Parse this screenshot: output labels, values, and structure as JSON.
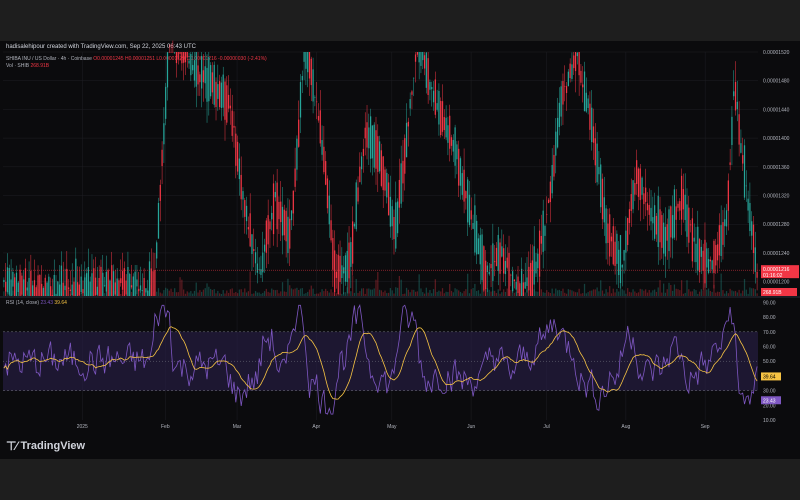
{
  "header": {
    "attribution": "hadisalehipour created with TradingView.com, Sep 22, 2025 06:43 UTC"
  },
  "legend": {
    "symbol": "SHIBA INU / US Dollar · 4h · Coinbase",
    "open": "O0.00001245",
    "high": "H0.00001251",
    "low": "L0.00001179",
    "close": "C0.00001216",
    "change": "-0.00000030 (-2.41%)",
    "vol_label": "Vol · SHIB",
    "vol_value": "268.91B"
  },
  "rsi_legend": {
    "label": "RSI (14, close)",
    "rsi_value": "23.43",
    "ma_value": "39.64"
  },
  "brand": {
    "name": "TradingView",
    "logo_icon": "tradingview-logo-icon"
  },
  "colors": {
    "up": "#26a69a",
    "down": "#f23645",
    "rsi_line": "#7e57c2",
    "rsi_ma": "#f6c343",
    "rsi_band": "#2a1f4a",
    "grid": "#1f1f24",
    "background": "#0b0b0d"
  },
  "chart_data": [
    {
      "type": "line",
      "subtype": "candlestick",
      "title": "SHIBA INU / US Dollar · 4h · Coinbase",
      "x_ticks": [
        "2025",
        "Feb",
        "Mar",
        "Apr",
        "May",
        "Jun",
        "Jul",
        "Aug",
        "Sep"
      ],
      "y_ticks": [
        "0.00001520",
        "0.00001480",
        "0.00001440",
        "0.00001400",
        "0.00001360",
        "0.00001320",
        "0.00001280",
        "0.00001240",
        "0.00001200"
      ],
      "ylim": [
        1.18e-05,
        1.52e-05
      ],
      "last_price_label": "0.00001216",
      "countdown_label": "01:16:02",
      "volume_label": "268.91B",
      "grid": true,
      "price_path": [
        {
          "x": 0,
          "y": 1.2e-05
        },
        {
          "x": 0.05,
          "y": 1.185e-05
        },
        {
          "x": 0.1,
          "y": 1.19e-05
        },
        {
          "x": 0.15,
          "y": 1.195e-05
        },
        {
          "x": 0.2,
          "y": 1.19e-05
        },
        {
          "x": 0.22,
          "y": 1.55e-05
        },
        {
          "x": 0.26,
          "y": 1.49e-05
        },
        {
          "x": 0.3,
          "y": 1.45e-05
        },
        {
          "x": 0.32,
          "y": 1.3e-05
        },
        {
          "x": 0.34,
          "y": 1.21e-05
        },
        {
          "x": 0.36,
          "y": 1.32e-05
        },
        {
          "x": 0.38,
          "y": 1.26e-05
        },
        {
          "x": 0.4,
          "y": 1.53e-05
        },
        {
          "x": 0.42,
          "y": 1.42e-05
        },
        {
          "x": 0.44,
          "y": 1.21e-05
        },
        {
          "x": 0.46,
          "y": 1.23e-05
        },
        {
          "x": 0.48,
          "y": 1.41e-05
        },
        {
          "x": 0.5,
          "y": 1.37e-05
        },
        {
          "x": 0.52,
          "y": 1.27e-05
        },
        {
          "x": 0.55,
          "y": 1.54e-05
        },
        {
          "x": 0.57,
          "y": 1.46e-05
        },
        {
          "x": 0.6,
          "y": 1.38e-05
        },
        {
          "x": 0.62,
          "y": 1.29e-05
        },
        {
          "x": 0.64,
          "y": 1.21e-05
        },
        {
          "x": 0.66,
          "y": 1.24e-05
        },
        {
          "x": 0.68,
          "y": 1.19e-05
        },
        {
          "x": 0.7,
          "y": 1.2e-05
        },
        {
          "x": 0.72,
          "y": 1.28e-05
        },
        {
          "x": 0.74,
          "y": 1.45e-05
        },
        {
          "x": 0.76,
          "y": 1.52e-05
        },
        {
          "x": 0.78,
          "y": 1.42e-05
        },
        {
          "x": 0.8,
          "y": 1.28e-05
        },
        {
          "x": 0.82,
          "y": 1.22e-05
        },
        {
          "x": 0.84,
          "y": 1.35e-05
        },
        {
          "x": 0.86,
          "y": 1.29e-05
        },
        {
          "x": 0.88,
          "y": 1.26e-05
        },
        {
          "x": 0.9,
          "y": 1.32e-05
        },
        {
          "x": 0.92,
          "y": 1.24e-05
        },
        {
          "x": 0.94,
          "y": 1.22e-05
        },
        {
          "x": 0.96,
          "y": 1.29e-05
        },
        {
          "x": 0.97,
          "y": 1.48e-05
        },
        {
          "x": 0.98,
          "y": 1.37e-05
        },
        {
          "x": 0.99,
          "y": 1.3e-05
        },
        {
          "x": 1.0,
          "y": 1.216e-05
        }
      ]
    },
    {
      "type": "line",
      "title": "RSI (14, close)",
      "x_ticks": [
        "2025",
        "Feb",
        "Mar",
        "Apr",
        "May",
        "Jun",
        "Jul",
        "Aug",
        "Sep"
      ],
      "y_ticks": [
        "90.00",
        "80.00",
        "70.00",
        "60.00",
        "50.00",
        "40.00",
        "30.00",
        "20.00",
        "10.00"
      ],
      "ylim": [
        10,
        93
      ],
      "bands": [
        30,
        70
      ],
      "series": [
        {
          "name": "RSI",
          "last": "23.43"
        },
        {
          "name": "MA",
          "last": "39.64"
        }
      ]
    }
  ]
}
